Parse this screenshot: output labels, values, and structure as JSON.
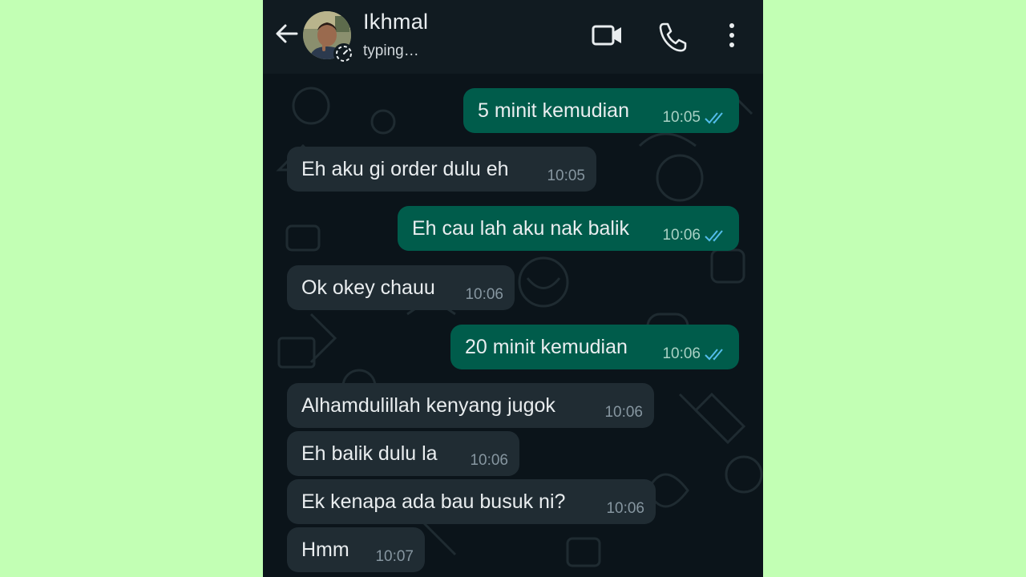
{
  "header": {
    "contact_name": "Ikhmal",
    "contact_status": "typing…",
    "icons": [
      "back-arrow-icon",
      "video-call-icon",
      "phone-icon",
      "more-vert-icon"
    ]
  },
  "colors": {
    "page_background": "#c2ffb4",
    "header": "#111b21",
    "chat_background": "#0b141a",
    "incoming_bubble": "#202c33",
    "outgoing_bubble": "#005c4b",
    "read_ticks": "#53bdeb"
  },
  "messages": [
    {
      "direction": "outgoing",
      "text": "5 minit kemudian",
      "time": "10:05",
      "read": true
    },
    {
      "direction": "incoming",
      "text": "Eh aku gi order dulu eh",
      "time": "10:05"
    },
    {
      "direction": "outgoing",
      "text": "Eh cau lah aku nak balik",
      "time": "10:06",
      "read": true
    },
    {
      "direction": "incoming",
      "text": "Ok okey chauu",
      "time": "10:06"
    },
    {
      "direction": "outgoing",
      "text": "20 minit kemudian",
      "time": "10:06",
      "read": true
    },
    {
      "direction": "incoming",
      "text": "Alhamdulillah kenyang jugok",
      "time": "10:06"
    },
    {
      "direction": "incoming",
      "text": "Eh balik dulu la",
      "time": "10:06"
    },
    {
      "direction": "incoming",
      "text": "Ek kenapa ada bau busuk ni?",
      "time": "10:06"
    },
    {
      "direction": "incoming",
      "text": "Hmm",
      "time": "10:07"
    }
  ]
}
